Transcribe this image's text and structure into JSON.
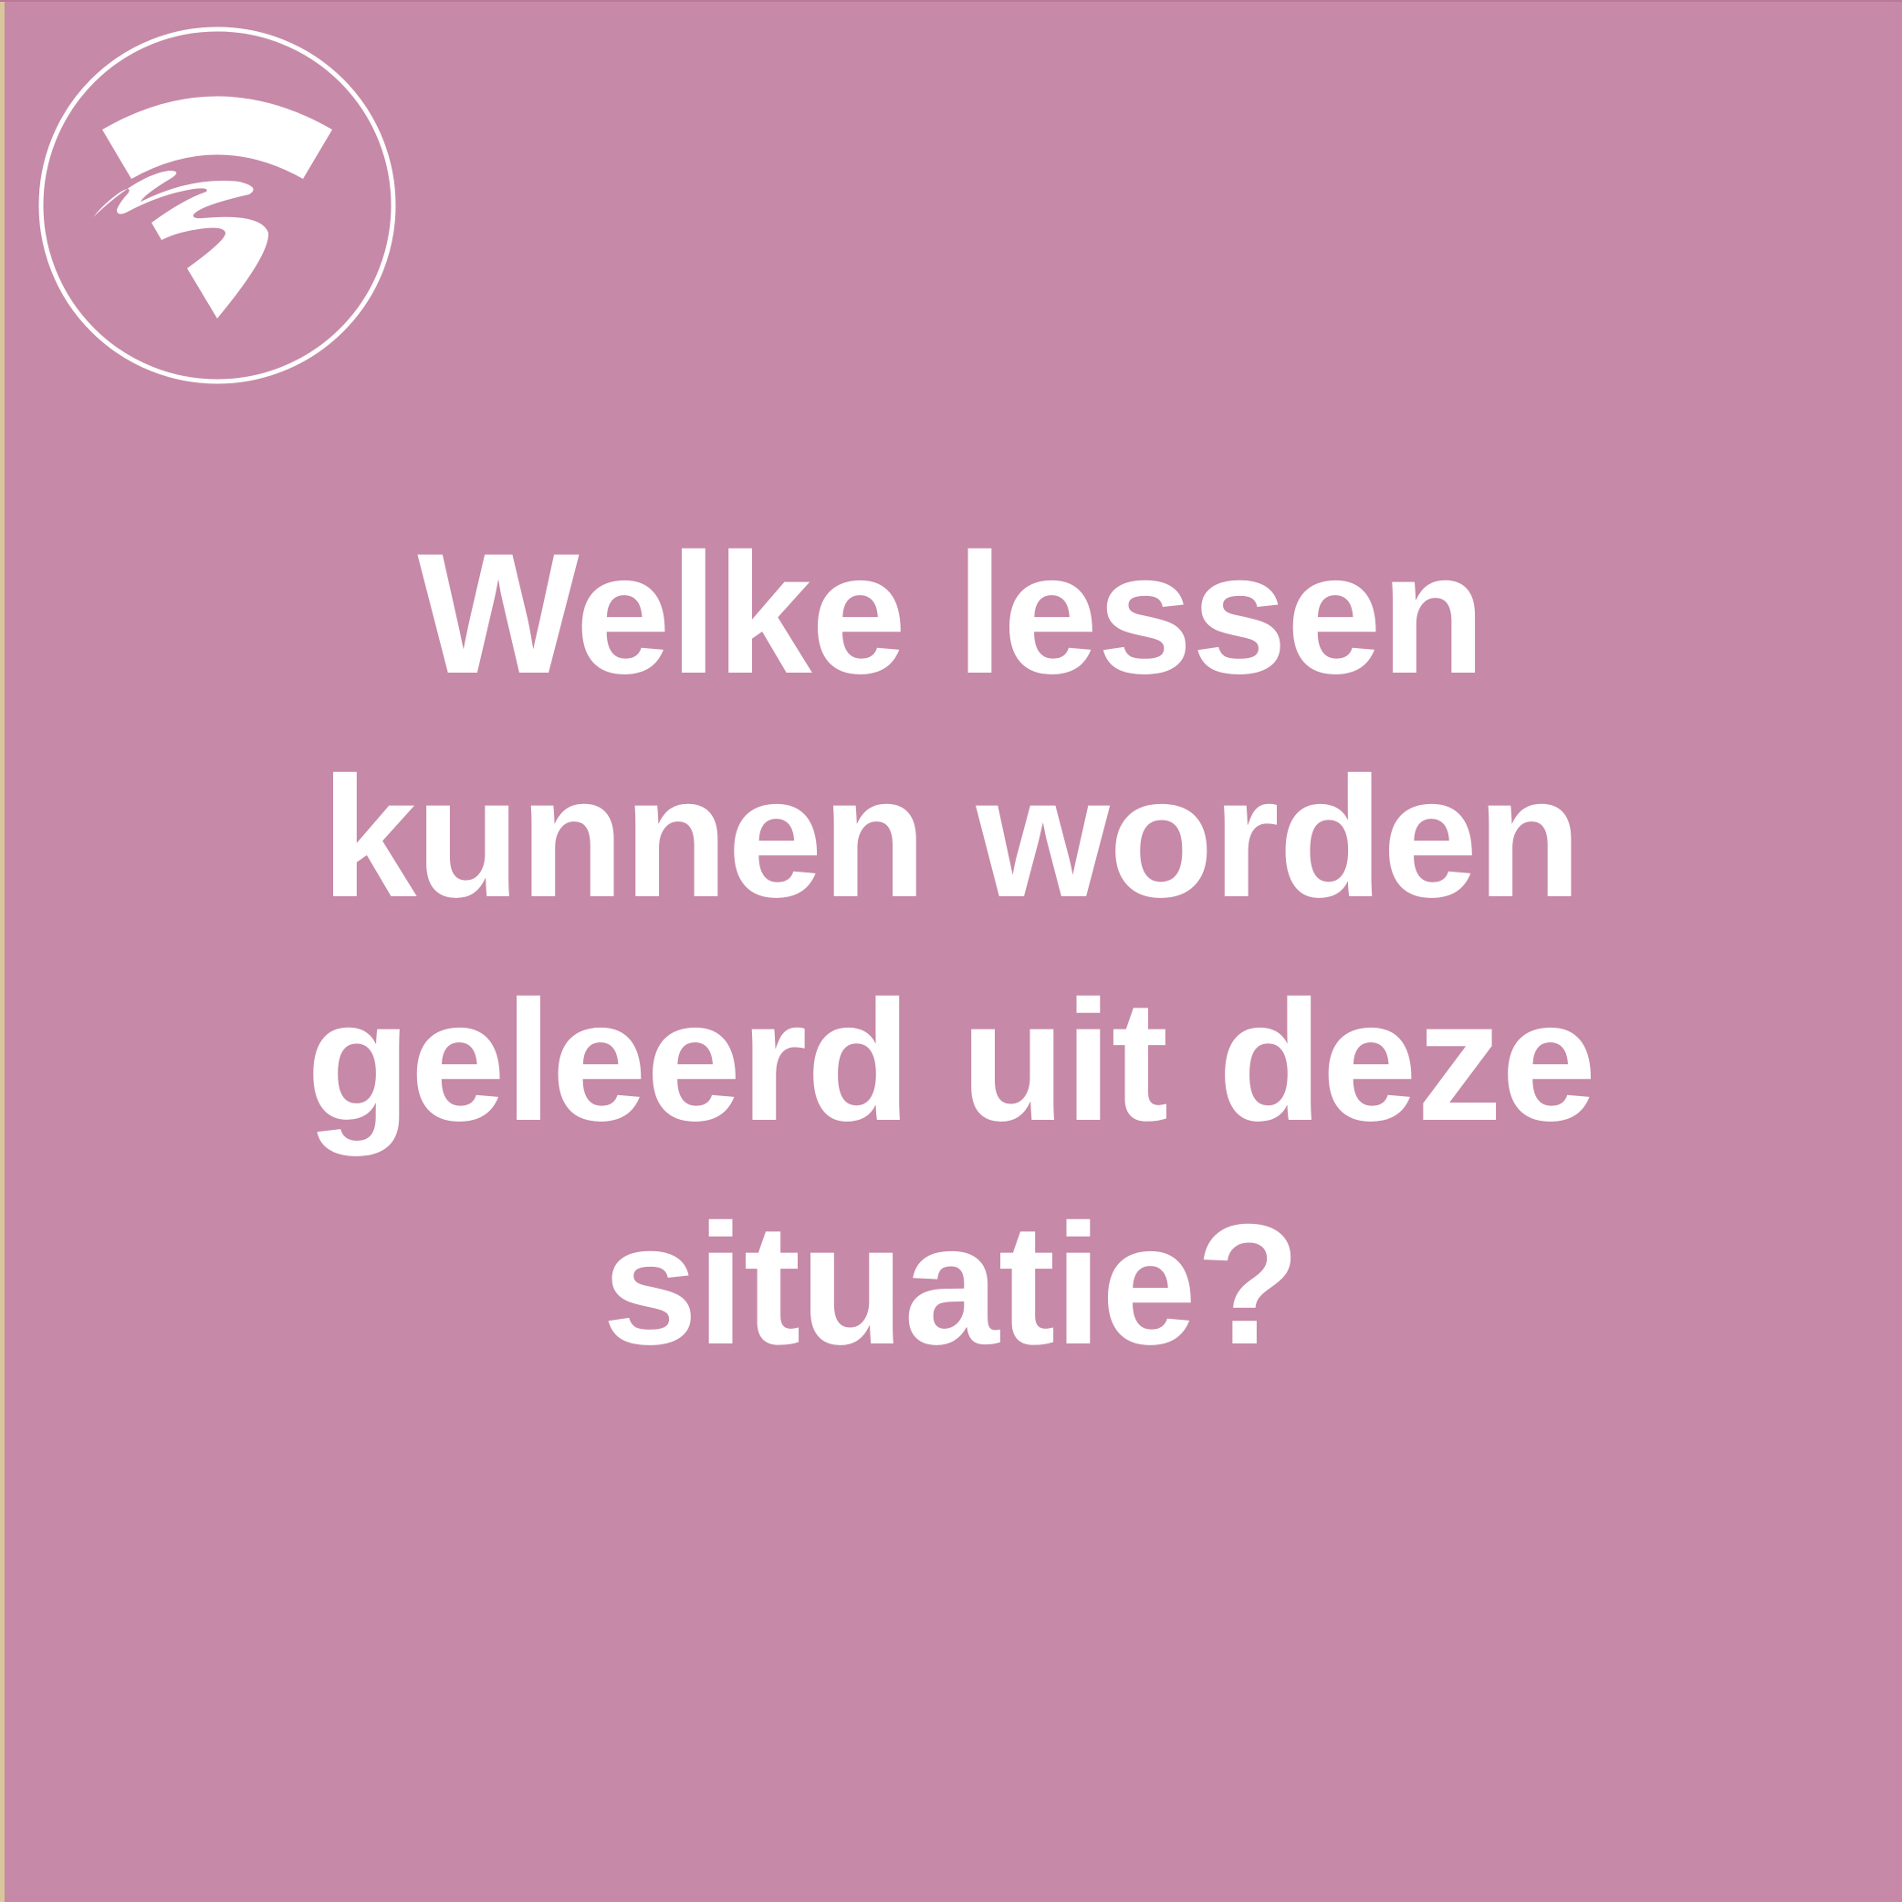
{
  "background_color": "#c689a7",
  "accent_color": "#ffffff",
  "logo": {
    "icon": "wifi-swoosh-emblem-icon"
  },
  "question": {
    "text": "Welke lessen kunnen worden geleerd uit deze situatie?"
  }
}
